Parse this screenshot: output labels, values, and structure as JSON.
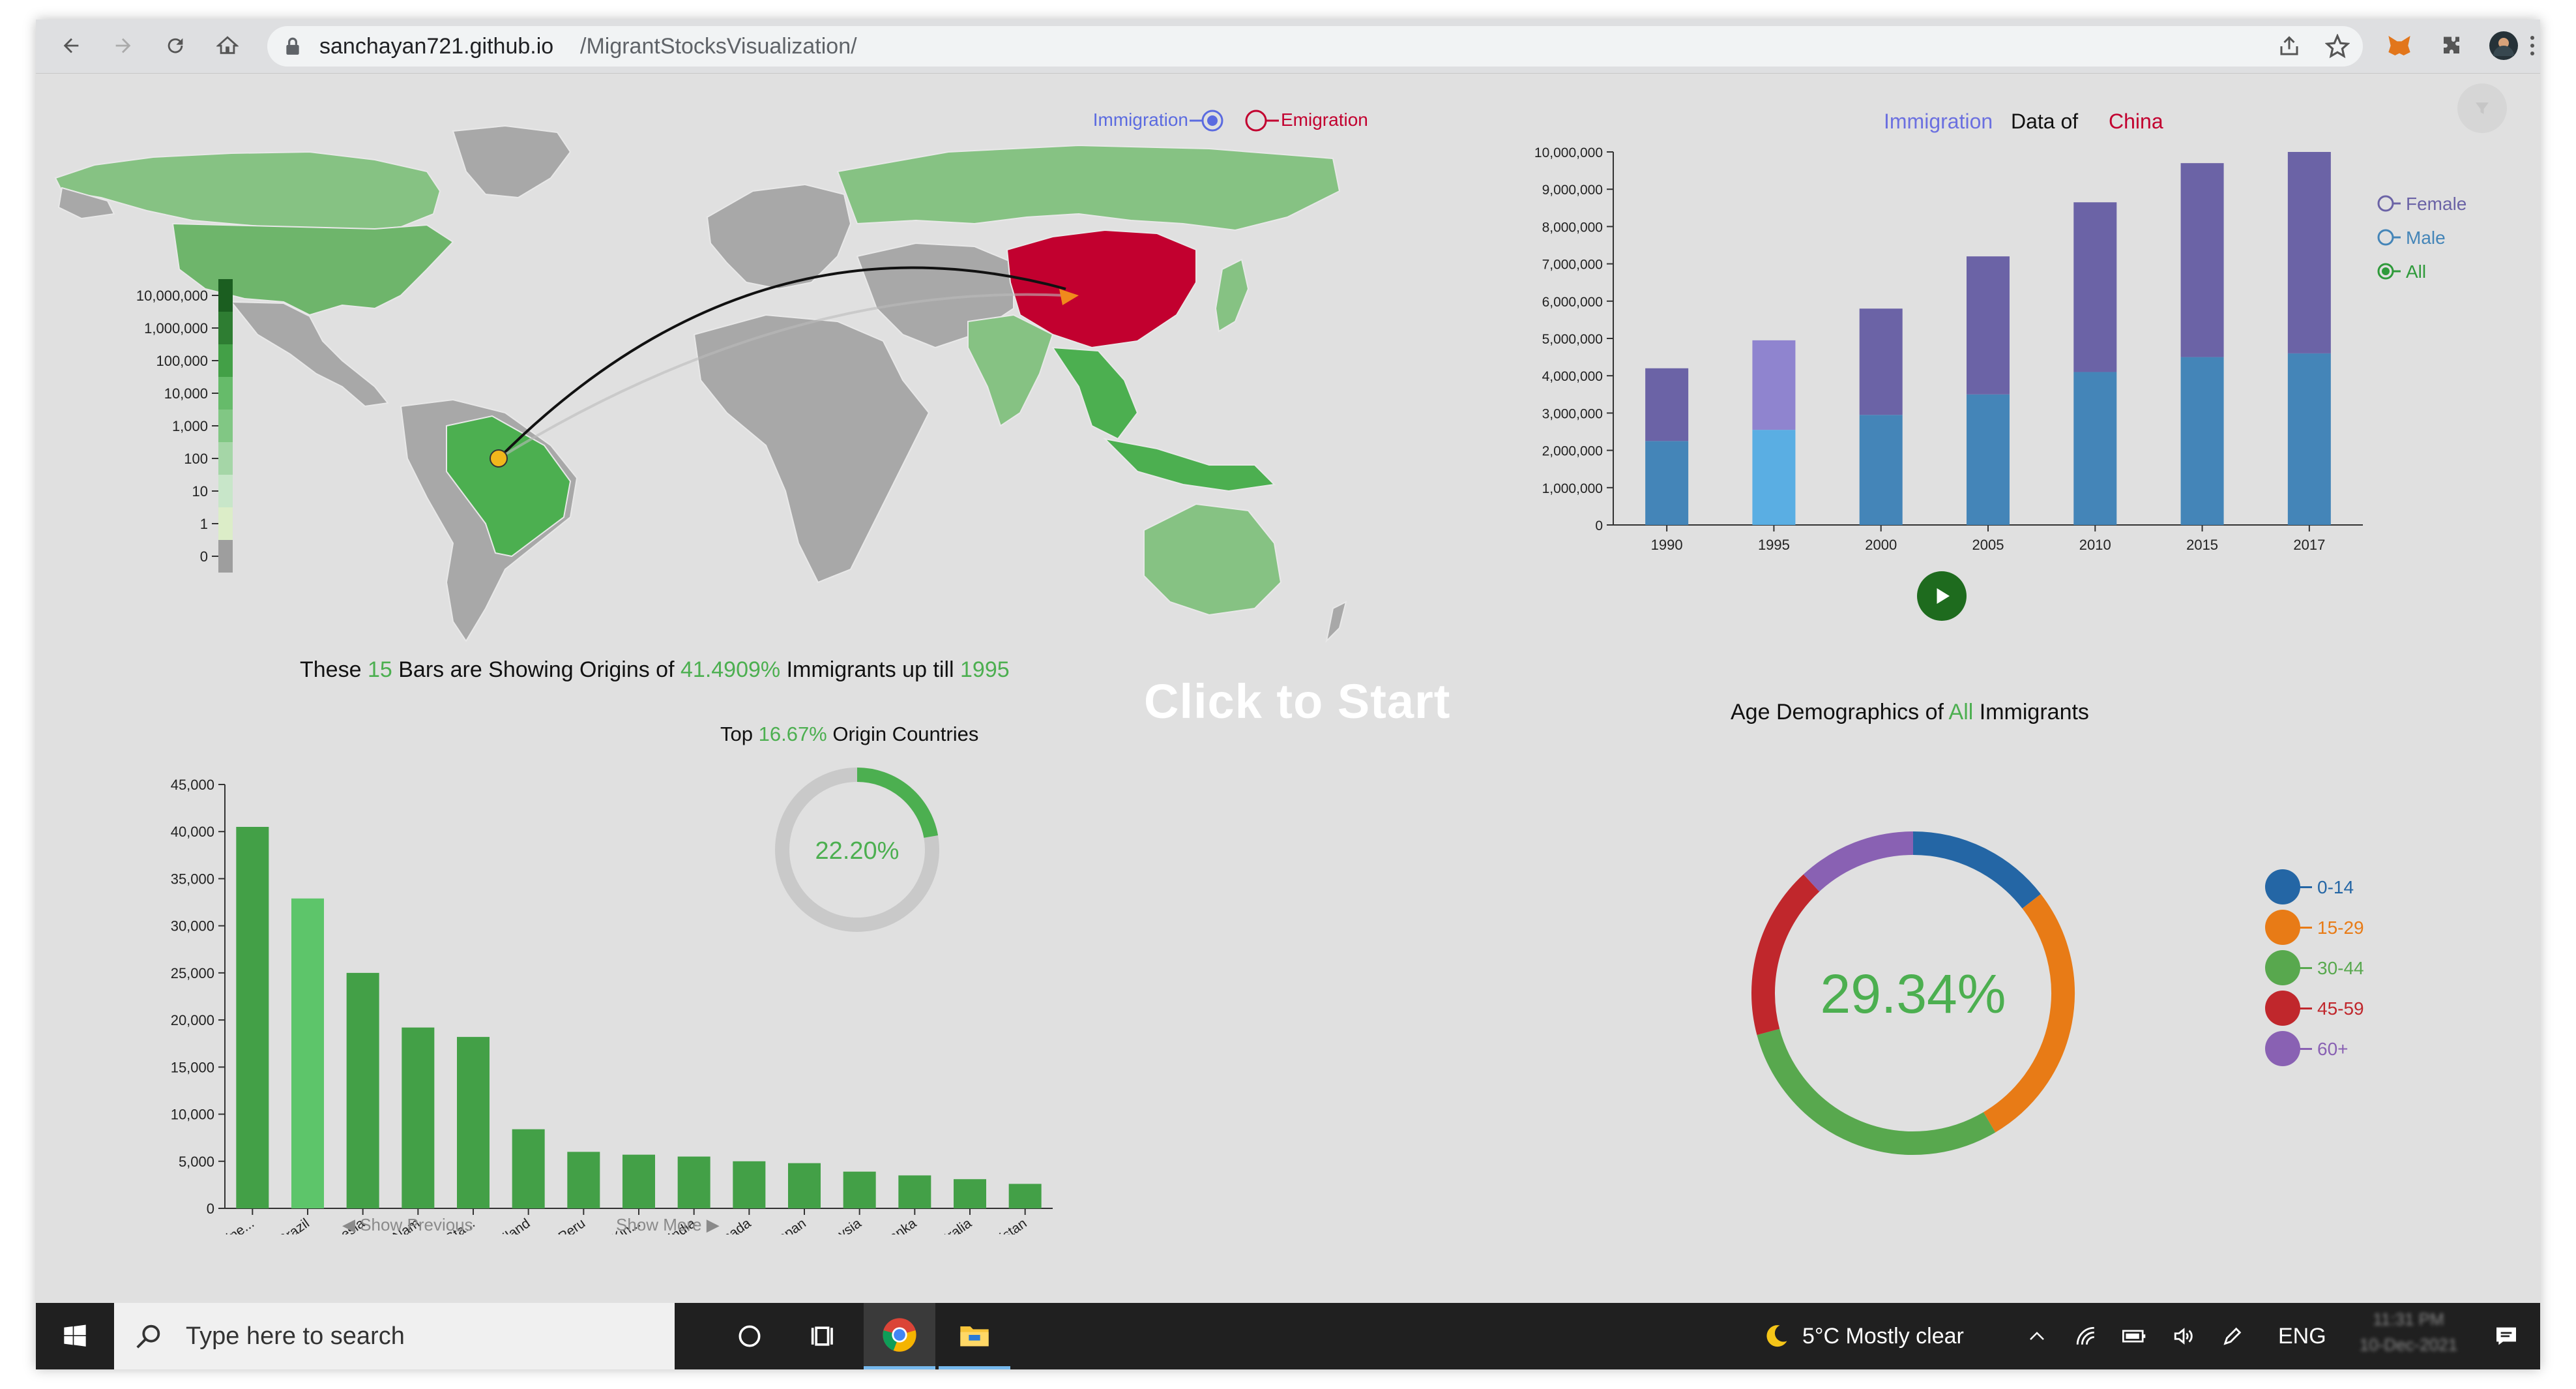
{
  "browser": {
    "url_host": "sanchayan721.github.io",
    "url_path": "/MigrantStocksVisualization/"
  },
  "toggle": {
    "immigration": "Immigration",
    "emigration": "Emigration"
  },
  "map_legend": [
    "10,000,000",
    "1,000,000",
    "100,000",
    "10,000",
    "1,000",
    "100",
    "10",
    "1",
    "0"
  ],
  "colors": {
    "green": "#4caf50",
    "dark_green": "#2e7d32",
    "china": "#c2002f",
    "purple": "#6b63a6",
    "blue": "#4485b8"
  },
  "immigration_chart": {
    "title_word1": "Immigration",
    "title_word2": "Data of",
    "title_word3": "China",
    "legend": [
      "Female",
      "Male",
      "All"
    ],
    "selected_legend": "All"
  },
  "bar_title": {
    "p1": "These",
    "count": "15",
    "p2": "Bars are Showing Origins of",
    "pct": "41.4909%",
    "p3": "Immigrants up till",
    "year": "1995"
  },
  "donut_small": {
    "title_p1": "Top",
    "title_pct": "16.67%",
    "title_p2": "Origin Countries",
    "value": "22.20%",
    "fraction": 0.222
  },
  "click_to_start": "Click to Start",
  "pager": {
    "prev": "◀ Show Previous",
    "next": "Show More ▶"
  },
  "age_chart": {
    "title_p1": "Age Demographics of",
    "title_highlight": "All",
    "title_p2": "Immigrants",
    "center_value": "29.34%"
  },
  "taskbar": {
    "search_placeholder": "Type here to search",
    "weather": "5°C  Mostly clear",
    "lang": "ENG",
    "time": "11:31 PM",
    "date": "10-Dec-2021"
  },
  "chart_data": [
    {
      "type": "bar",
      "title": "Immigration Data of China",
      "categories": [
        "1990",
        "1995",
        "2000",
        "2005",
        "2010",
        "2015",
        "2017"
      ],
      "series": [
        {
          "name": "Male",
          "values": [
            2250000,
            2550000,
            2950000,
            3500000,
            4100000,
            4500000,
            4600000
          ]
        },
        {
          "name": "Female",
          "values": [
            1950000,
            2400000,
            2850000,
            3700000,
            4550000,
            5200000,
            5400000
          ]
        }
      ],
      "ylim": [
        0,
        10000000
      ],
      "yticks": [
        "0",
        "1,000,000",
        "2,000,000",
        "3,000,000",
        "4,000,000",
        "5,000,000",
        "6,000,000",
        "7,000,000",
        "8,000,000",
        "9,000,000",
        "10,000,000"
      ],
      "highlight_category": "1995"
    },
    {
      "type": "bar",
      "title": "These 15 Bars are Showing Origins of 41.4909% Immigrants up till 1995",
      "categories": [
        "Philippine...",
        "Brazil",
        "Indonesia",
        "Viet Nam",
        "United Sta...",
        "Thailand",
        "Peru",
        "United Kin...",
        "India",
        "Canada",
        "Japan",
        "Malaysia",
        "Sri Lanka",
        "Australia",
        "Pakistan"
      ],
      "values": [
        40500,
        32900,
        25000,
        19200,
        18200,
        8400,
        6000,
        5700,
        5500,
        5000,
        4800,
        3900,
        3500,
        3100,
        2600
      ],
      "ylim": [
        0,
        45000
      ],
      "yticks": [
        "0",
        "5,000",
        "10,000",
        "15,000",
        "20,000",
        "25,000",
        "30,000",
        "35,000",
        "40,000",
        "45,000"
      ],
      "highlight_category": "Brazil"
    },
    {
      "type": "pie",
      "title": "Age Demographics of All Immigrants",
      "categories": [
        "0-14",
        "15-29",
        "30-44",
        "45-59",
        "60+"
      ],
      "values": [
        14.5,
        27.0,
        29.34,
        17.3,
        11.86
      ],
      "colors": [
        "#2466a5",
        "#e87b16",
        "#58a84e",
        "#c0272c",
        "#8961b3"
      ]
    }
  ]
}
